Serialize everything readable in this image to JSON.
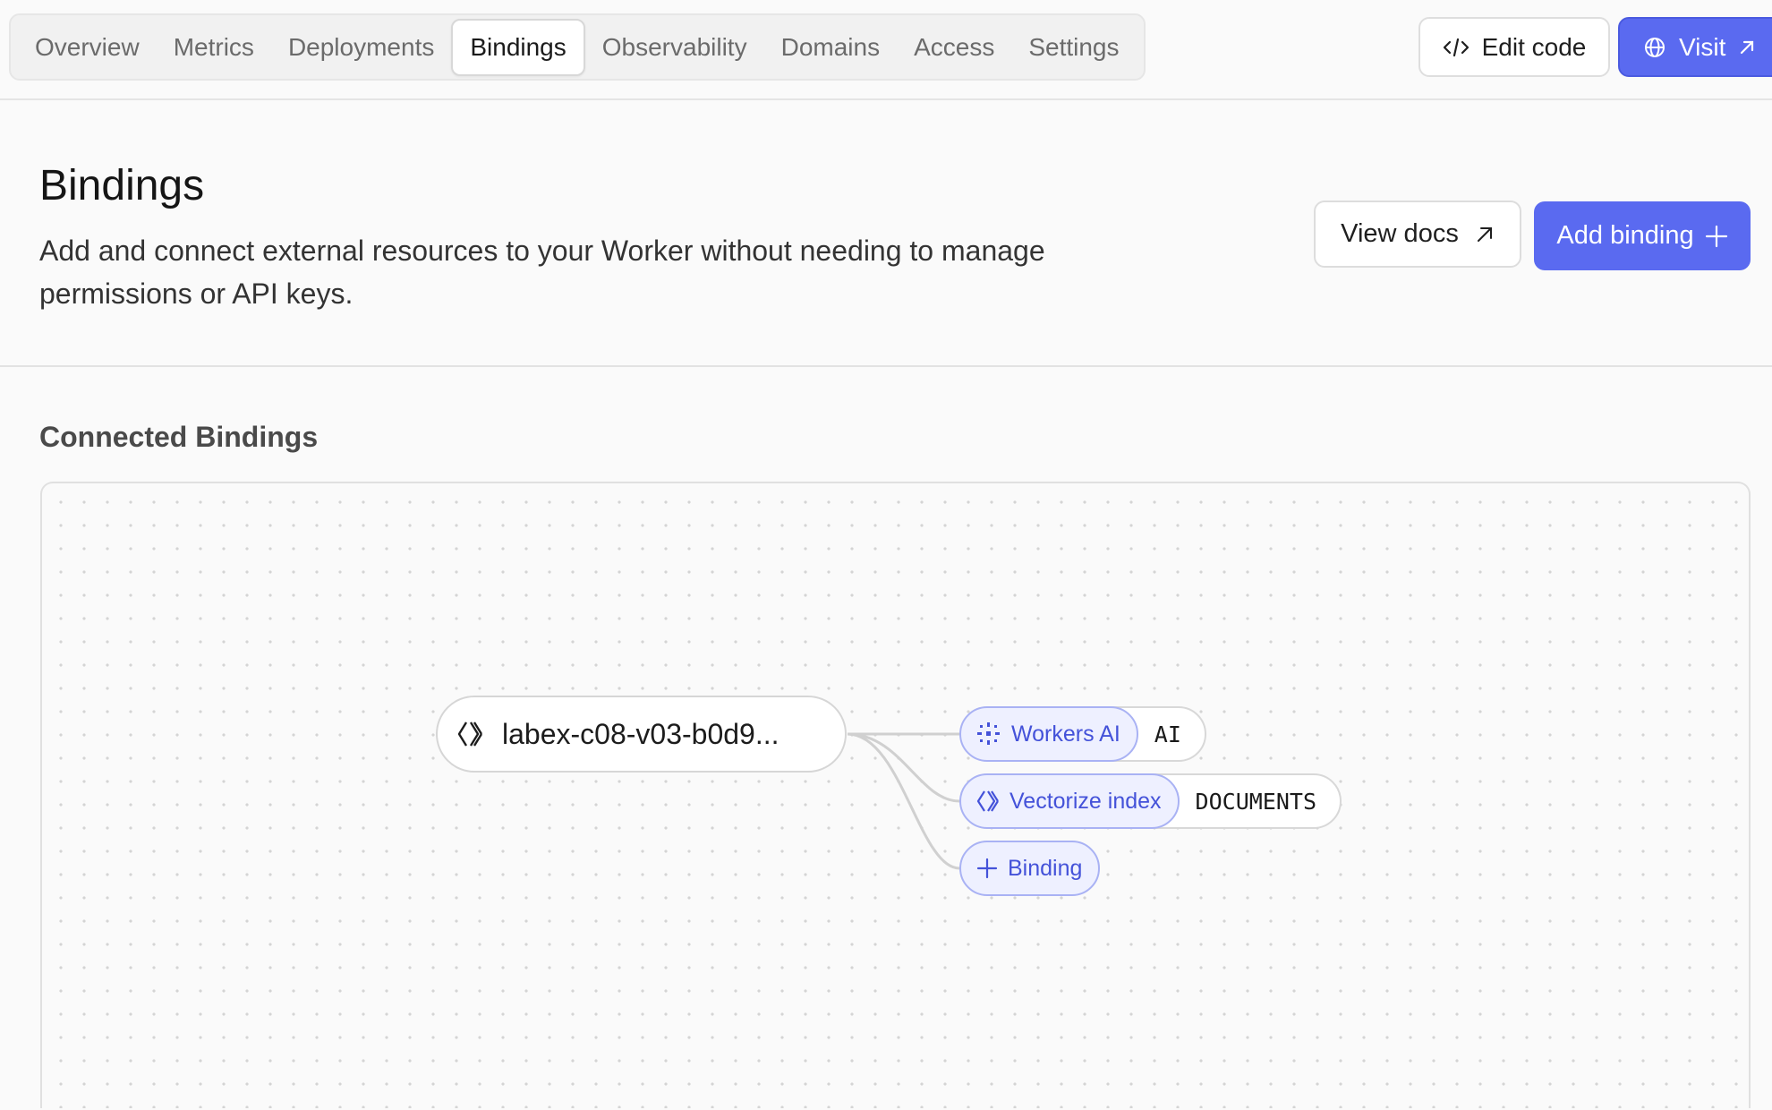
{
  "tabs": [
    {
      "label": "Overview"
    },
    {
      "label": "Metrics"
    },
    {
      "label": "Deployments"
    },
    {
      "label": "Bindings"
    },
    {
      "label": "Observability"
    },
    {
      "label": "Domains"
    },
    {
      "label": "Access"
    },
    {
      "label": "Settings"
    }
  ],
  "active_tab": "Bindings",
  "top_actions": {
    "edit_code_label": "Edit code",
    "visit_label": "Visit"
  },
  "header": {
    "title": "Bindings",
    "description": "Add and connect external resources to your Worker without needing to manage permissions or API keys.",
    "view_docs_label": "View docs",
    "add_binding_label": "Add binding"
  },
  "connected": {
    "title": "Connected Bindings",
    "worker_name": "labex-c08-v03-b0d9...",
    "bindings": [
      {
        "type": "Workers AI",
        "name": "AI",
        "icon": "workers-ai-sparkle-icon"
      },
      {
        "type": "Vectorize index",
        "name": "DOCUMENTS",
        "icon": "vectorize-icon"
      }
    ],
    "add_binding_chip": "Binding"
  },
  "colors": {
    "accent": "#5a6af0",
    "chip_bg": "#eef0ff",
    "chip_border": "#a9b2f4",
    "chip_text": "#4452d9"
  }
}
